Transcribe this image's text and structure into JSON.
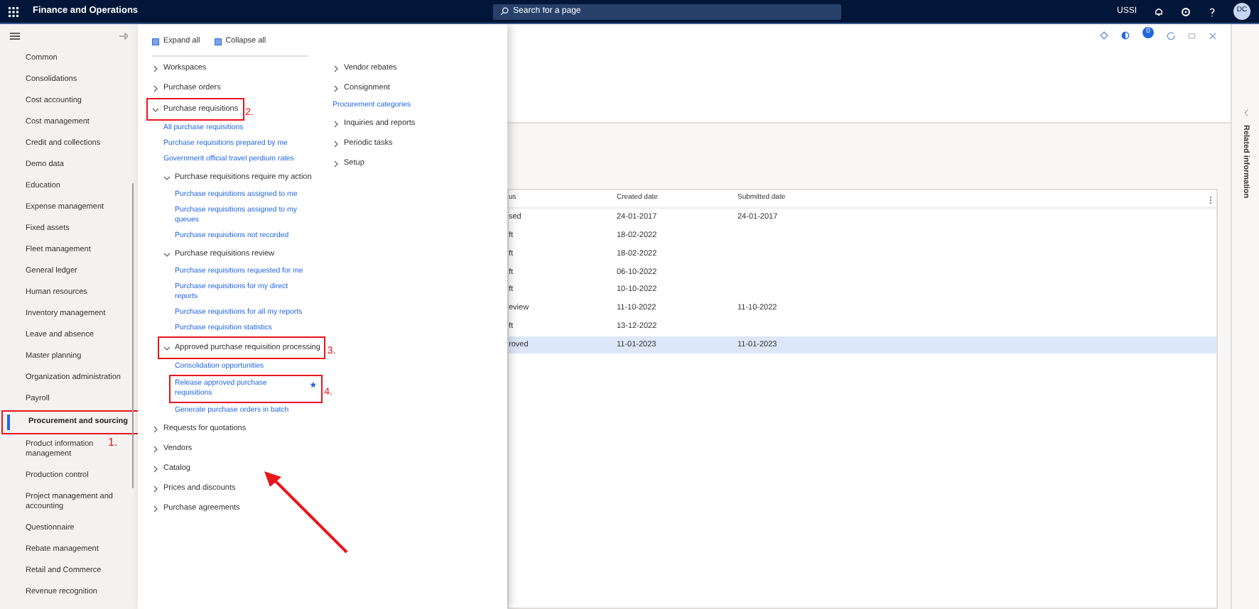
{
  "app": {
    "title": "Finance and Operations",
    "search": {
      "placeholder": "Search for a page"
    },
    "company": "USSI",
    "avatar": "DC"
  },
  "toolbar": {
    "badge": "0"
  },
  "sidebar": {
    "items": [
      {
        "label": "Common",
        "selected": false
      },
      {
        "label": "Consolidations",
        "selected": false
      },
      {
        "label": "Cost accounting",
        "selected": false
      },
      {
        "label": "Cost management",
        "selected": false
      },
      {
        "label": "Credit and collections",
        "selected": false
      },
      {
        "label": "Demo data",
        "selected": false
      },
      {
        "label": "Education",
        "selected": false
      },
      {
        "label": "Expense management",
        "selected": false
      },
      {
        "label": "Fixed assets",
        "selected": false
      },
      {
        "label": "Fleet management",
        "selected": false
      },
      {
        "label": "General ledger",
        "selected": false
      },
      {
        "label": "Human resources",
        "selected": false
      },
      {
        "label": "Inventory management",
        "selected": false
      },
      {
        "label": "Leave and absence",
        "selected": false
      },
      {
        "label": "Master planning",
        "selected": false
      },
      {
        "label": "Organization administration",
        "selected": false
      },
      {
        "label": "Payroll",
        "selected": false
      },
      {
        "label": "Procurement and sourcing",
        "selected": true,
        "callout": "1."
      },
      {
        "label": "Product information management",
        "selected": false
      },
      {
        "label": "Production control",
        "selected": false
      },
      {
        "label": "Project management and accounting",
        "selected": false
      },
      {
        "label": "Questionnaire",
        "selected": false
      },
      {
        "label": "Rebate management",
        "selected": false
      },
      {
        "label": "Retail and Commerce",
        "selected": false
      },
      {
        "label": "Revenue recognition",
        "selected": false
      }
    ]
  },
  "menu": {
    "expand_all": "Expand all",
    "collapse_all": "Collapse all",
    "columns": [
      [
        {
          "kind": "group",
          "label": "Workspaces",
          "expanded": false
        },
        {
          "kind": "group",
          "label": "Purchase orders",
          "expanded": false
        },
        {
          "kind": "group",
          "label": "Purchase requisitions",
          "expanded": true,
          "callout": "2.",
          "children": [
            {
              "kind": "link",
              "label": "All purchase requisitions"
            },
            {
              "kind": "link",
              "label": "Purchase requisitions prepared by me"
            },
            {
              "kind": "link",
              "label": "Government official travel perdium rates"
            },
            {
              "kind": "group",
              "label": "Purchase requisitions require my action",
              "expanded": true,
              "children": [
                {
                  "kind": "link",
                  "label": "Purchase requisitions assigned to me"
                },
                {
                  "kind": "link",
                  "label": "Purchase requisitions assigned to my queues"
                },
                {
                  "kind": "link",
                  "label": "Purchase requisitions not recorded"
                }
              ]
            },
            {
              "kind": "group",
              "label": "Purchase requisitions review",
              "expanded": true,
              "children": [
                {
                  "kind": "link",
                  "label": "Purchase requisitions requested for me"
                },
                {
                  "kind": "link",
                  "label": "Purchase requisitions for my direct reports"
                },
                {
                  "kind": "link",
                  "label": "Purchase requisitions for all my reports"
                },
                {
                  "kind": "link",
                  "label": "Purchase requisition statistics"
                }
              ]
            },
            {
              "kind": "group",
              "label": "Approved purchase requisition processing",
              "expanded": true,
              "callout": "3.",
              "children": [
                {
                  "kind": "link",
                  "label": "Consolidation opportunities"
                },
                {
                  "kind": "link",
                  "label": "Release approved purchase requisitions",
                  "favorite": true,
                  "callout": "4."
                },
                {
                  "kind": "link",
                  "label": "Generate purchase orders in batch"
                }
              ]
            }
          ]
        },
        {
          "kind": "group",
          "label": "Requests for quotations",
          "expanded": false
        },
        {
          "kind": "group",
          "label": "Vendors",
          "expanded": false
        },
        {
          "kind": "group",
          "label": "Catalog",
          "expanded": false
        },
        {
          "kind": "group",
          "label": "Prices and discounts",
          "expanded": false
        },
        {
          "kind": "group",
          "label": "Purchase agreements",
          "expanded": false
        }
      ],
      [
        {
          "kind": "group",
          "label": "Vendor rebates",
          "expanded": false
        },
        {
          "kind": "group",
          "label": "Consignment",
          "expanded": false
        },
        {
          "kind": "link",
          "label": "Procurement categories"
        },
        {
          "kind": "group",
          "label": "Inquiries and reports",
          "expanded": false
        },
        {
          "kind": "group",
          "label": "Periodic tasks",
          "expanded": false
        },
        {
          "kind": "group",
          "label": "Setup",
          "expanded": false
        }
      ]
    ]
  },
  "table": {
    "columns": [
      "us",
      "Created date",
      "Submitted date"
    ],
    "rows": [
      {
        "cells": [
          "sed",
          "24-01-2017",
          "24-01-2017"
        ],
        "selected": false
      },
      {
        "cells": [
          "ft",
          "18-02-2022",
          ""
        ],
        "selected": false
      },
      {
        "cells": [
          "ft",
          "18-02-2022",
          ""
        ],
        "selected": false
      },
      {
        "cells": [
          "ft",
          "06-10-2022",
          ""
        ],
        "selected": false
      },
      {
        "cells": [
          "ft",
          "10-10-2022",
          ""
        ],
        "selected": false
      },
      {
        "cells": [
          "eview",
          "11-10-2022",
          "11-10-2022"
        ],
        "selected": false
      },
      {
        "cells": [
          "ft",
          "13-12-2022",
          ""
        ],
        "selected": false
      },
      {
        "cells": [
          "roved",
          "11-01-2023",
          "11-01-2023"
        ],
        "selected": true
      }
    ]
  },
  "related_panel": {
    "title": "Related information"
  }
}
